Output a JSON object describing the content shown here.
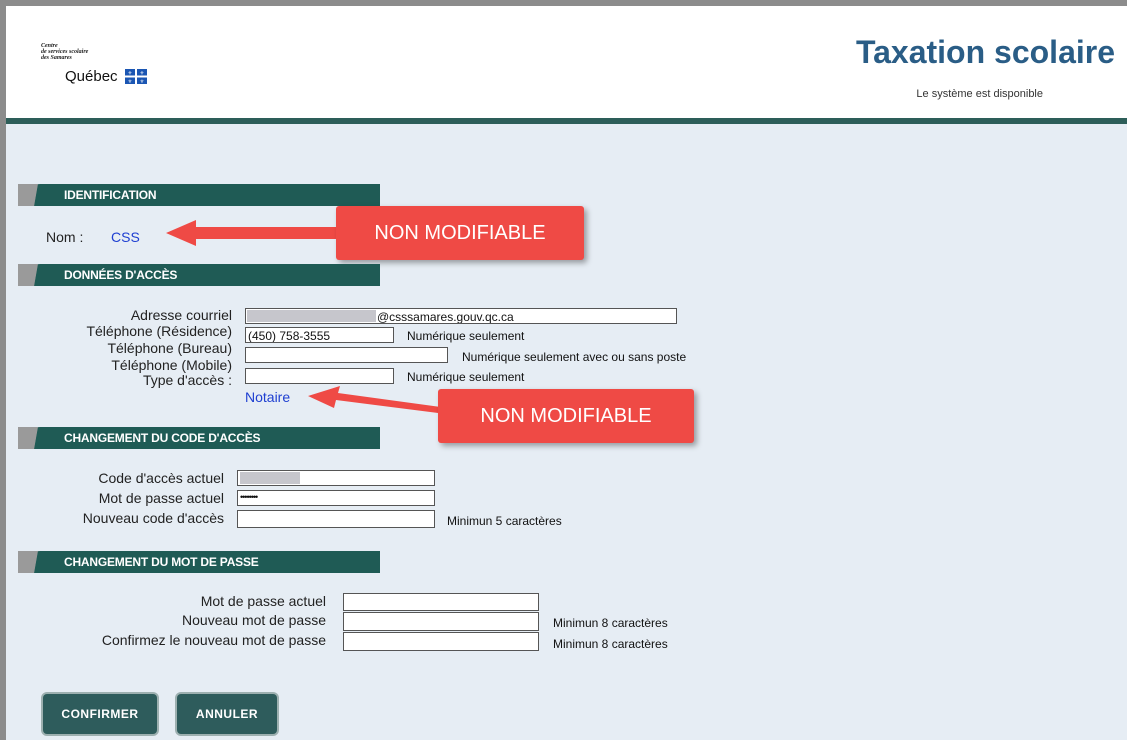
{
  "header": {
    "logo_small_lines": [
      "Centre",
      "de services scolaire",
      "des Samares"
    ],
    "logo_main": "Québec",
    "title": "Taxation scolaire",
    "status": "Le système est disponible"
  },
  "sections": {
    "identification": "IDENTIFICATION",
    "acces": "DONNÉES D'ACCÈS",
    "code": "CHANGEMENT DU CODE D'ACCÈS",
    "password": "CHANGEMENT DU MOT DE PASSE"
  },
  "identification": {
    "nom_label": "Nom :",
    "nom_value": "CSS"
  },
  "access": {
    "email_label": "Adresse courriel",
    "email_value": "@csssamares.gouv.qc.ca",
    "tel_res_label": "Téléphone (Résidence)",
    "tel_res_value": "(450) 758-3555",
    "tel_res_hint": "Numérique seulement",
    "tel_bureau_label": "Téléphone (Bureau)",
    "tel_bureau_value": "",
    "tel_bureau_hint": "Numérique seulement avec ou sans poste",
    "tel_mobile_label": "Téléphone (Mobile)",
    "tel_mobile_value": "",
    "tel_mobile_hint": "Numérique seulement",
    "type_label": "Type d'accès :",
    "type_value": "Notaire"
  },
  "code_change": {
    "current_code_label": "Code d'accès actuel",
    "current_code_value": "",
    "current_pw_label": "Mot de passe actuel",
    "current_pw_value": "••••••••",
    "new_code_label": "Nouveau code d'accès",
    "new_code_value": "",
    "new_code_hint": "Minimun 5 caractères"
  },
  "password_change": {
    "current_label": "Mot de passe actuel",
    "current_value": "",
    "new_label": "Nouveau mot de passe",
    "new_value": "",
    "new_hint": "Minimun 8 caractères",
    "confirm_label": "Confirmez le nouveau mot de passe",
    "confirm_value": "",
    "confirm_hint": "Minimun 8 caractères"
  },
  "callouts": {
    "first": "NON MODIFIABLE",
    "second": "NON MODIFIABLE"
  },
  "buttons": {
    "confirm": "CONFIRMER",
    "cancel": "ANNULER"
  },
  "colors": {
    "accent": "#1f5b55",
    "title": "#2a5d86",
    "callout": "#ef4a45",
    "link_value": "#1e3fd1"
  }
}
